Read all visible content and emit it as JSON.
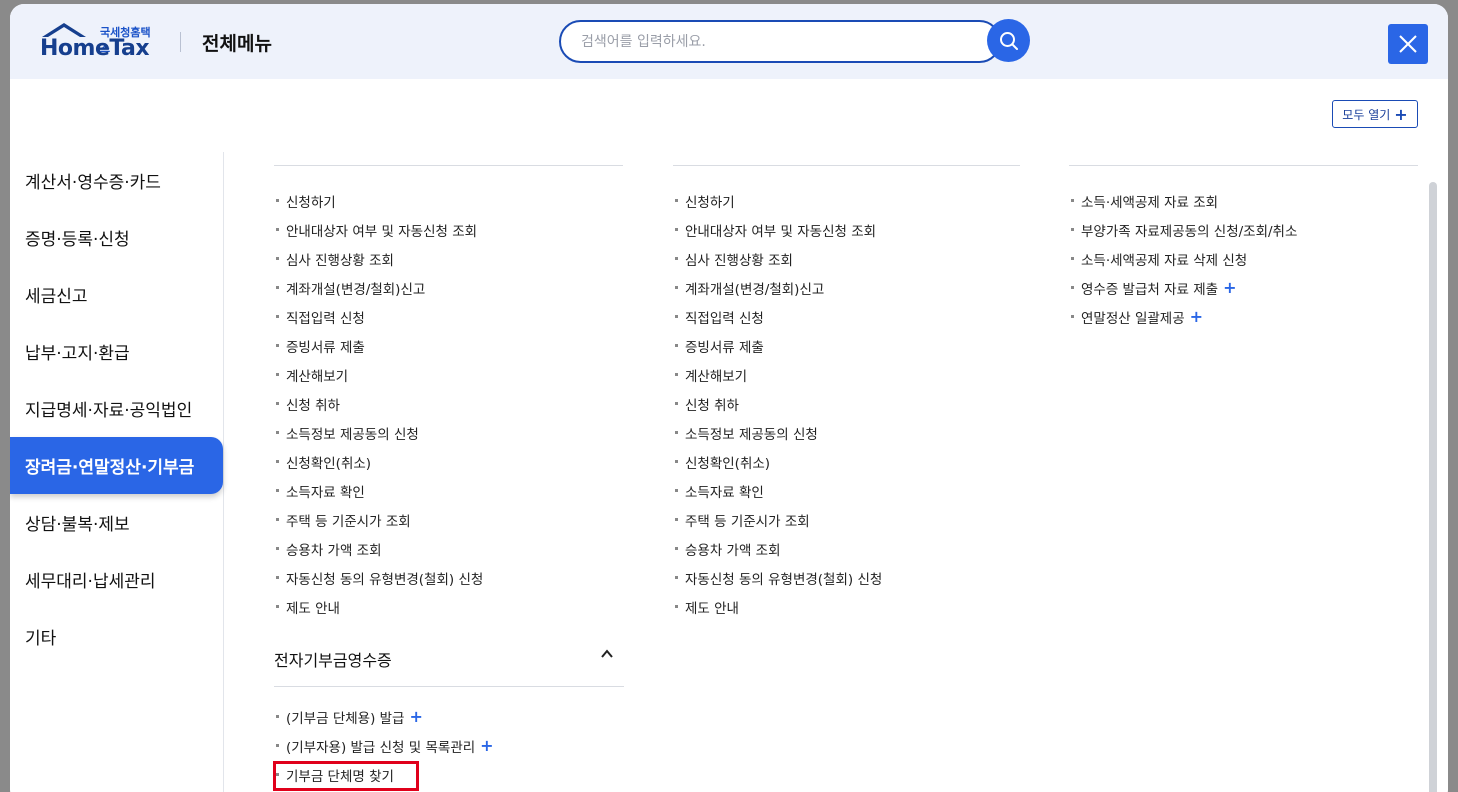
{
  "header": {
    "logo_small": "국세청홈택스",
    "logo_main": "HomeTax",
    "title": "전체메뉴",
    "search_placeholder": "검색어를 입력하세요."
  },
  "open_all_label": "모두 열기",
  "sidebar": {
    "items": [
      {
        "label": "계산서·영수증·카드"
      },
      {
        "label": "증명·등록·신청"
      },
      {
        "label": "세금신고"
      },
      {
        "label": "납부·고지·환급"
      },
      {
        "label": "지급명세·자료·공익법인"
      },
      {
        "label": "장려금·연말정산·기부금",
        "active": true
      },
      {
        "label": "상담·불복·제보"
      },
      {
        "label": "세무대리·납세관리"
      },
      {
        "label": "기타"
      }
    ]
  },
  "col1": {
    "items": [
      "신청하기",
      "안내대상자 여부 및 자동신청 조회",
      "심사 진행상황 조회",
      "계좌개설(변경/철회)신고",
      "직접입력 신청",
      "증빙서류 제출",
      "계산해보기",
      "신청 취하",
      "소득정보 제공동의 신청",
      "신청확인(취소)",
      "소득자료 확인",
      "주택 등 기준시가 조회",
      "승용차 가액 조회",
      "자동신청 동의 유형변경(철회) 신청",
      "제도 안내"
    ]
  },
  "col2": {
    "items": [
      "신청하기",
      "안내대상자 여부 및 자동신청 조회",
      "심사 진행상황 조회",
      "계좌개설(변경/철회)신고",
      "직접입력 신청",
      "증빙서류 제출",
      "계산해보기",
      "신청 취하",
      "소득정보 제공동의 신청",
      "신청확인(취소)",
      "소득자료 확인",
      "주택 등 기준시가 조회",
      "승용차 가액 조회",
      "자동신청 동의 유형변경(철회) 신청",
      "제도 안내"
    ]
  },
  "col3": {
    "items": [
      {
        "label": "소득·세액공제 자료 조회",
        "plus": false
      },
      {
        "label": "부양가족 자료제공동의 신청/조회/취소",
        "plus": false
      },
      {
        "label": "소득·세액공제 자료 삭제 신청",
        "plus": false
      },
      {
        "label": "영수증 발급처 자료 제출",
        "plus": true
      },
      {
        "label": "연말정산 일괄제공",
        "plus": true
      }
    ]
  },
  "section": {
    "title": "전자기부금영수증",
    "items": [
      {
        "label": "(기부금 단체용) 발급",
        "plus": true
      },
      {
        "label": "(기부자용) 발급 신청 및 목록관리",
        "plus": true
      },
      {
        "label": "기부금 단체명 찾기",
        "plus": false
      }
    ]
  },
  "colors": {
    "accent": "#2a66e6",
    "highlight": "#e0001b"
  }
}
